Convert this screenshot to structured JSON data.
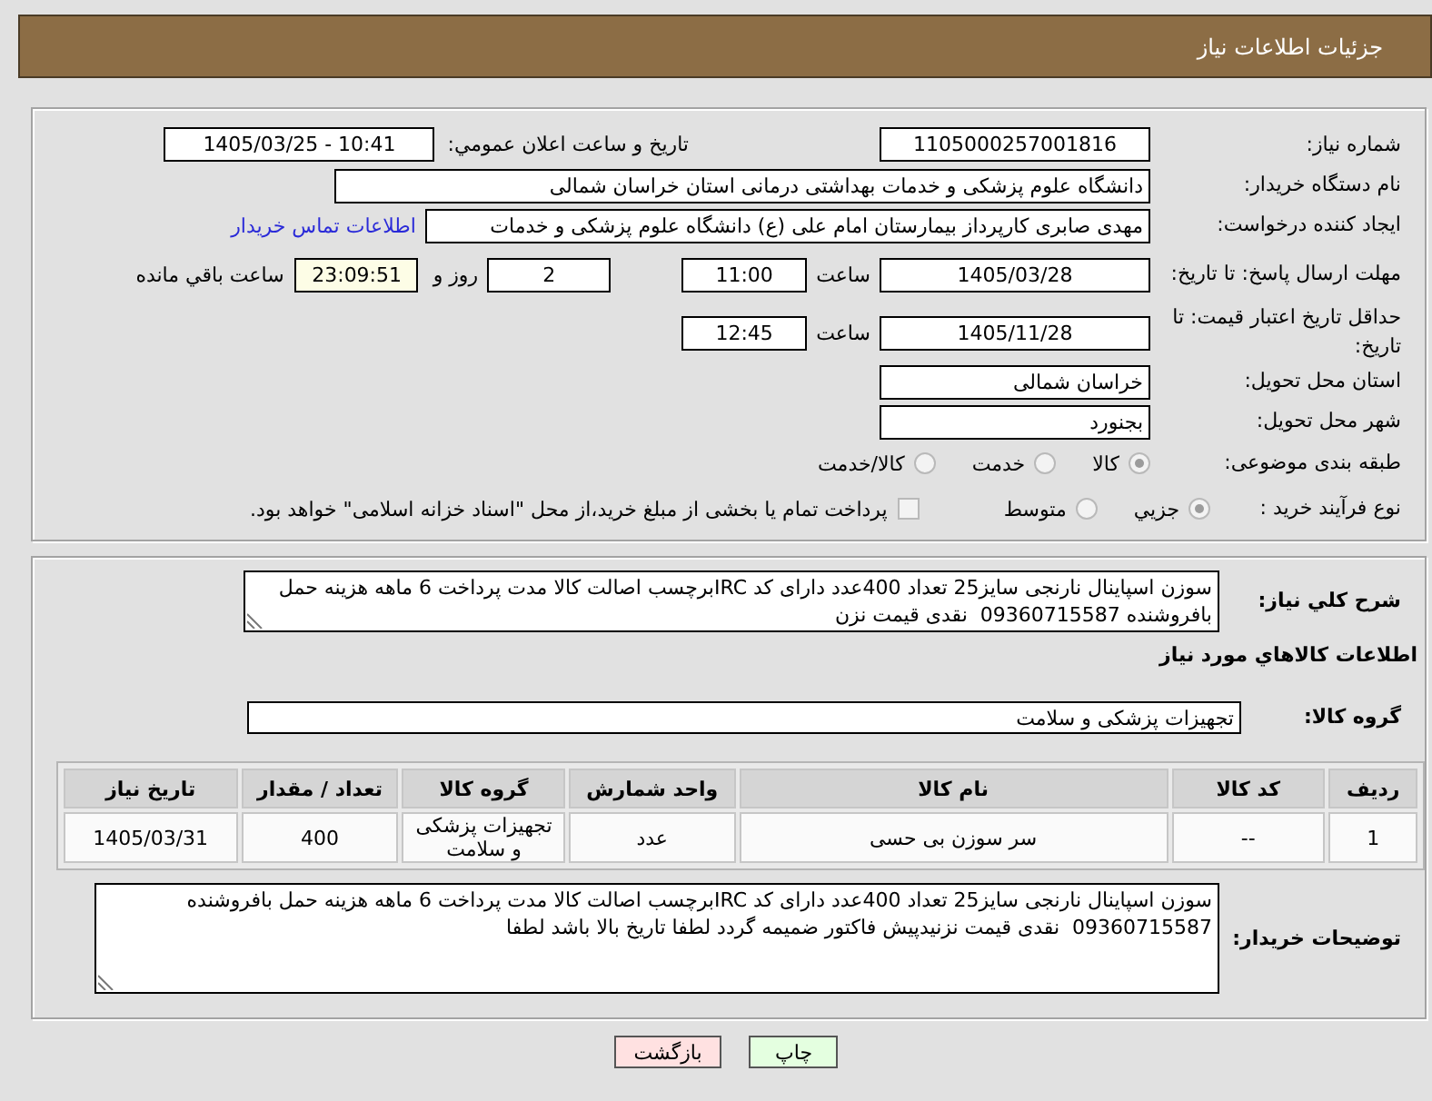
{
  "header": {
    "title": "جزئیات اطلاعات نیاز"
  },
  "need_info": {
    "need_number": {
      "label": "شماره نیاز:",
      "value": "1105000257001816"
    },
    "announce_datetime": {
      "label": "تاریخ و ساعت اعلان عمومي:",
      "value": "1405/03/25 - 10:41"
    },
    "buyer_org": {
      "label": "نام دستگاه خریدار:",
      "value": "دانشگاه علوم پزشکی و خدمات بهداشتی درمانی استان خراسان شمالی"
    },
    "requester": {
      "label": "ایجاد کننده درخواست:",
      "value": "مهدی صابری کارپرداز بیمارستان امام علی (ع) دانشگاه علوم پزشکی و خدمات",
      "link": "اطلاعات تماس خریدار"
    },
    "reply_deadline": {
      "label": "مهلت ارسال پاسخ: تا تاریخ:",
      "date": "1405/03/28",
      "time_label": "ساعت",
      "time": "11:00",
      "days": "2",
      "days_label": "روز و",
      "remaining": "23:09:51",
      "remaining_label": "ساعت باقي مانده"
    },
    "price_validity": {
      "label": "حداقل تاریخ اعتبار قیمت: تا تاریخ:",
      "date": "1405/11/28",
      "time_label": "ساعت",
      "time": "12:45"
    },
    "delivery_province": {
      "label": "استان محل تحویل:",
      "value": "خراسان شمالی"
    },
    "delivery_city": {
      "label": "شهر محل تحویل:",
      "value": "بجنورد"
    },
    "category": {
      "label": "طبقه بندی موضوعی:",
      "options": [
        {
          "label": "کالا",
          "selected": true
        },
        {
          "label": "خدمت",
          "selected": false
        },
        {
          "label": "کالا/خدمت",
          "selected": false
        }
      ]
    },
    "purchase_type": {
      "label": "نوع فرآیند خرید :",
      "options": [
        {
          "label": "جزیي",
          "selected": true
        },
        {
          "label": "متوسط",
          "selected": false
        }
      ],
      "treasury": {
        "label": "پرداخت تمام یا بخشی از مبلغ خرید،از محل \"اسناد خزانه اسلامی\" خواهد بود.",
        "checked": false
      }
    }
  },
  "details": {
    "description": {
      "label": "شرح کلي نیاز:",
      "value": "سوزن اسپاینال نارنجی سایز25 تعداد 400عدد دارای کد IRCبرچسب اصالت کالا مدت پرداخت 6 ماهه هزینه حمل بافروشنده 09360715587  نقدی قیمت نزن"
    },
    "goods_title": "اطلاعات کالاهاي مورد نیاز",
    "goods_group": {
      "label": "گروه کالا:",
      "value": "تجهیزات پزشکی و سلامت"
    },
    "table": {
      "columns": [
        "ردیف",
        "کد کالا",
        "نام کالا",
        "واحد شمارش",
        "گروه کالا",
        "تعداد / مقدار",
        "تاریخ نیاز"
      ],
      "rows": [
        [
          "1",
          "--",
          "سر سوزن بی حسی",
          "عدد",
          "تجهیزات پزشکی و سلامت",
          "400",
          "1405/03/31"
        ]
      ]
    },
    "buyer_notes": {
      "label": "توضیحات خریدار:",
      "value": "سوزن اسپاینال نارنجی سایز25 تعداد 400عدد دارای کد IRCبرچسب اصالت کالا مدت پرداخت 6 ماهه هزینه حمل بافروشنده 09360715587  نقدی قیمت نزنیدپیش فاکتور ضمیمه گردد لطفا تاریخ بالا باشد لطفا"
    }
  },
  "buttons": [
    {
      "label": "چاپ",
      "kind": "print"
    },
    {
      "label": "بازگشت",
      "kind": "back"
    }
  ]
}
